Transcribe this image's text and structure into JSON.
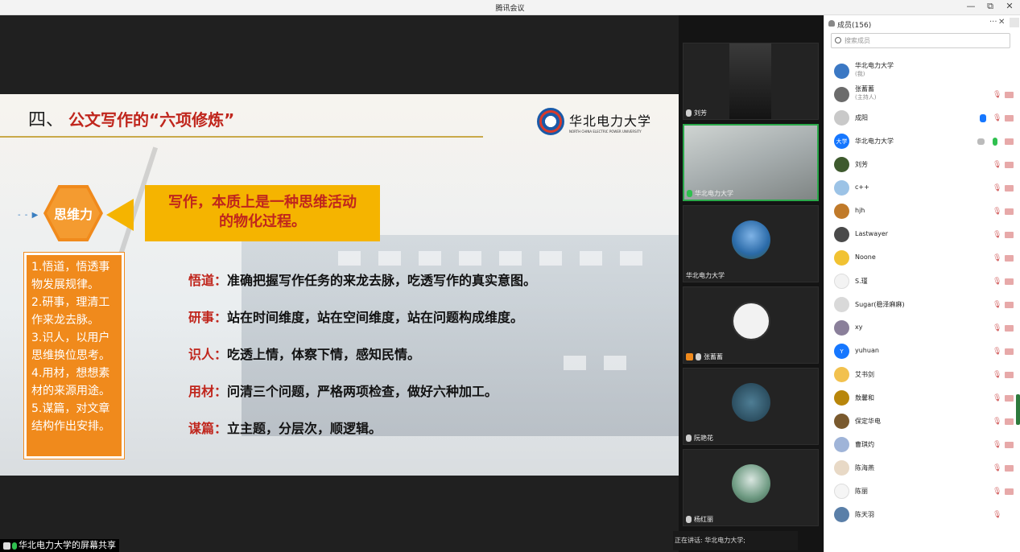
{
  "window": {
    "title": "腾讯会议",
    "minimize": "—",
    "maximize": "⧉",
    "close": "✕"
  },
  "slide": {
    "number": "四、",
    "title": "公文写作的“六项修炼”",
    "logo_cn": "华北电力大学",
    "logo_en": "NORTH CHINA ELECTRIC POWER UNIVERSITY",
    "hex_label": "思维力",
    "callout_line1": "写作，本质上是一种思维活动",
    "callout_line2": "的物化过程。",
    "left_card": [
      "1.悟道，悟透事",
      "物发展规律。",
      "2.研事，理清工",
      "作来龙去脉。",
      "3.识人，以用户",
      "思维换位思考。",
      "4.用材，想想素",
      "材的来源用途。",
      "5.谋篇，对文章",
      "结构作出安排。"
    ],
    "bullets": [
      {
        "key": "悟道：",
        "text": "准确把握写作任务的来龙去脉，吃透写作的真实意图。"
      },
      {
        "key": "研事：",
        "text": "站在时间维度，站在空间维度，站在问题构成维度。"
      },
      {
        "key": "识人：",
        "text": "吃透上情，体察下情，感知民情。"
      },
      {
        "key": "用材：",
        "text": "问清三个问题，严格两项检查，做好六种加工。"
      },
      {
        "key": "谋篇：",
        "text": "立主题，分层次，顺逻辑。"
      }
    ]
  },
  "share_label": "华北电力大学的屏幕共享",
  "video_tiles": [
    {
      "name": "刘芳",
      "active": false
    },
    {
      "name": "华北电力大学",
      "active": true
    },
    {
      "name": "华北电力大学",
      "active": false
    },
    {
      "name": "张蓄蓄",
      "active": false
    },
    {
      "name": "阮艳花",
      "active": false
    },
    {
      "name": "杨红丽",
      "active": false
    }
  ],
  "speaking": "正在讲话: 华北电力大学;",
  "panel": {
    "title": "成员(156)",
    "more": "···",
    "close": "✕",
    "search_placeholder": "搜索成员",
    "members": [
      {
        "name": "华北电力大学",
        "role": "(我)",
        "color": "#3b78c4"
      },
      {
        "name": "张蓄蓄",
        "role": "(主持人)",
        "color": "#6b6b6b"
      },
      {
        "name": "成阳",
        "role": "",
        "color": "#c9c9c9"
      },
      {
        "name": "华北电力大学",
        "role": "",
        "color": "#1677ff",
        "badge": "大学"
      },
      {
        "name": "刘芳",
        "role": "",
        "color": "#3e5a2e"
      },
      {
        "name": "c++",
        "role": "",
        "color": "#9cc3e6"
      },
      {
        "name": "hjh",
        "role": "",
        "color": "#c07a2a"
      },
      {
        "name": "Lastwayer",
        "role": "",
        "color": "#4a4a4a"
      },
      {
        "name": "Noone",
        "role": "",
        "color": "#f1c232"
      },
      {
        "name": "S.瑾",
        "role": "",
        "color": "#f3f3f3"
      },
      {
        "name": "Sugar(稳泽麻麻)",
        "role": "",
        "color": "#d9d9d9"
      },
      {
        "name": "xy",
        "role": "",
        "color": "#8a7f9a"
      },
      {
        "name": "yuhuan",
        "role": "",
        "color": "#1677ff",
        "badge": "Y"
      },
      {
        "name": "艾书剑",
        "role": "",
        "color": "#f2c14e"
      },
      {
        "name": "敖馨和",
        "role": "",
        "color": "#b8860b"
      },
      {
        "name": "保定华电",
        "role": "",
        "color": "#7a5a2e"
      },
      {
        "name": "曹琪灼",
        "role": "",
        "color": "#9fb4d8"
      },
      {
        "name": "陈海燕",
        "role": "",
        "color": "#e8d9c6"
      },
      {
        "name": "陈丽",
        "role": "",
        "color": "#f5f5f5"
      },
      {
        "name": "陈天羽",
        "role": "",
        "color": "#5a7fa8"
      }
    ]
  },
  "colors": {
    "accent_orange": "#f08a1c",
    "callout_yellow": "#f5b400",
    "title_red": "#c0261d",
    "active_green": "#2aa84a"
  }
}
